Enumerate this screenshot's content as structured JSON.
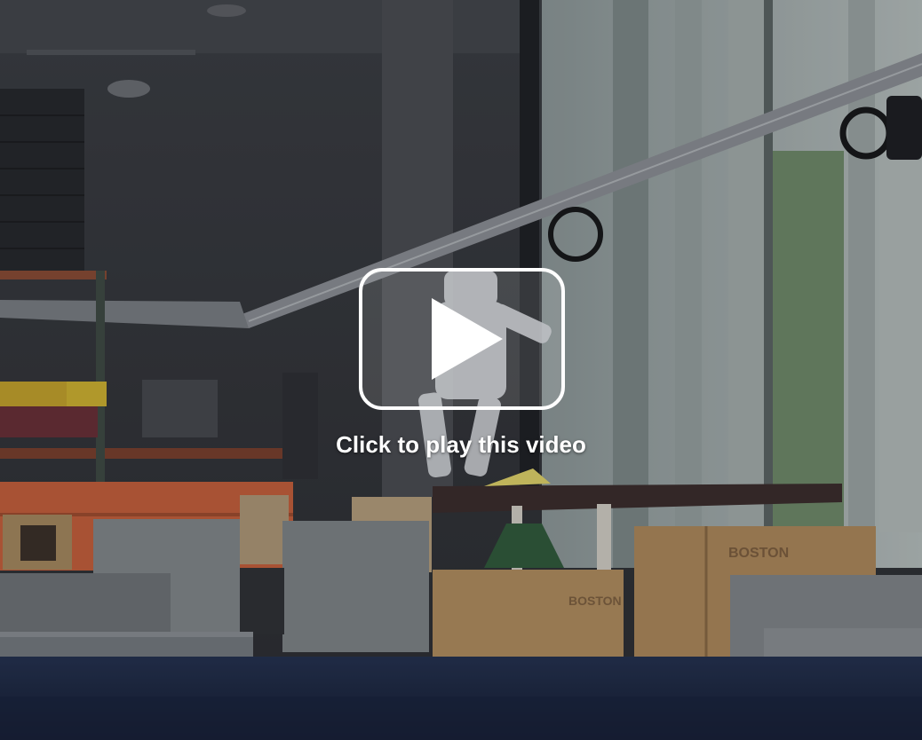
{
  "video": {
    "play_prompt": "Click to play this video",
    "state": "paused",
    "play_icon": "play-icon"
  },
  "scene": {
    "crate_marking": "BOSTON"
  },
  "colors": {
    "overlay_text": "#ffffff",
    "play_button_border": "#ffffff",
    "floor": "#1c2a4a",
    "orange_blocks": "#c9603a",
    "plywood": "#b48f5f"
  }
}
